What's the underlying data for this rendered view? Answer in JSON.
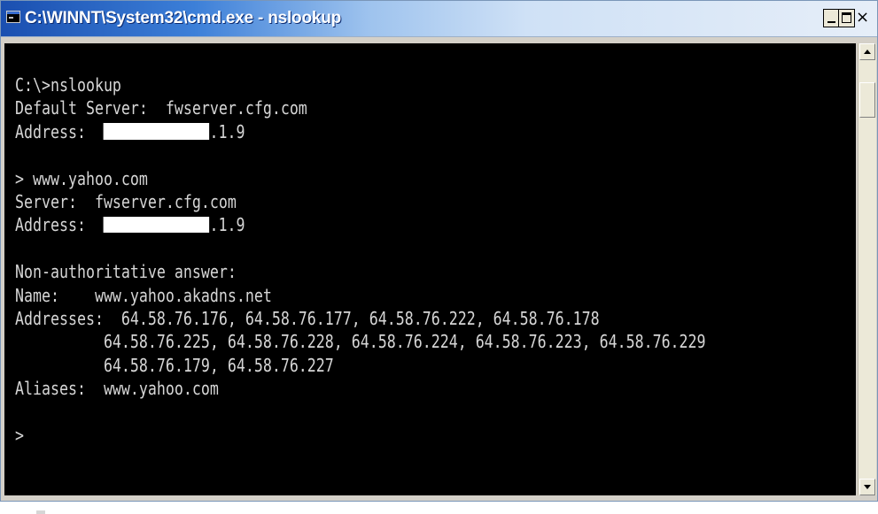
{
  "window": {
    "title": "C:\\WINNT\\System32\\cmd.exe - nslookup",
    "icon": "console-app-icon",
    "controls": {
      "minimize": "minimize-icon",
      "maximize": "maximize-icon",
      "close": "×"
    }
  },
  "console": {
    "lines": {
      "l1": "C:\\>nslookup",
      "l2": "Default Server:  fwserver.cfg.com",
      "l3_prefix": "Address:  ",
      "l3_suffix": ".1.9",
      "l5": "> www.yahoo.com",
      "l6": "Server:  fwserver.cfg.com",
      "l7_prefix": "Address:  ",
      "l7_suffix": ".1.9",
      "l9": "Non-authoritative answer:",
      "l10": "Name:    www.yahoo.akadns.net",
      "l11": "Addresses:  64.58.76.176, 64.58.76.177, 64.58.76.222, 64.58.76.178",
      "l12": "          64.58.76.225, 64.58.76.228, 64.58.76.224, 64.58.76.223, 64.58.76.229",
      "l13": "          64.58.76.179, 64.58.76.227",
      "l14": "Aliases:  www.yahoo.com",
      "l16": ">"
    }
  },
  "colors": {
    "console_bg": "#000000",
    "console_fg": "#d6d6d6",
    "titlebar_start": "#1a4fb0",
    "titlebar_end": "#e6eef8",
    "redaction": "#ffffff"
  }
}
